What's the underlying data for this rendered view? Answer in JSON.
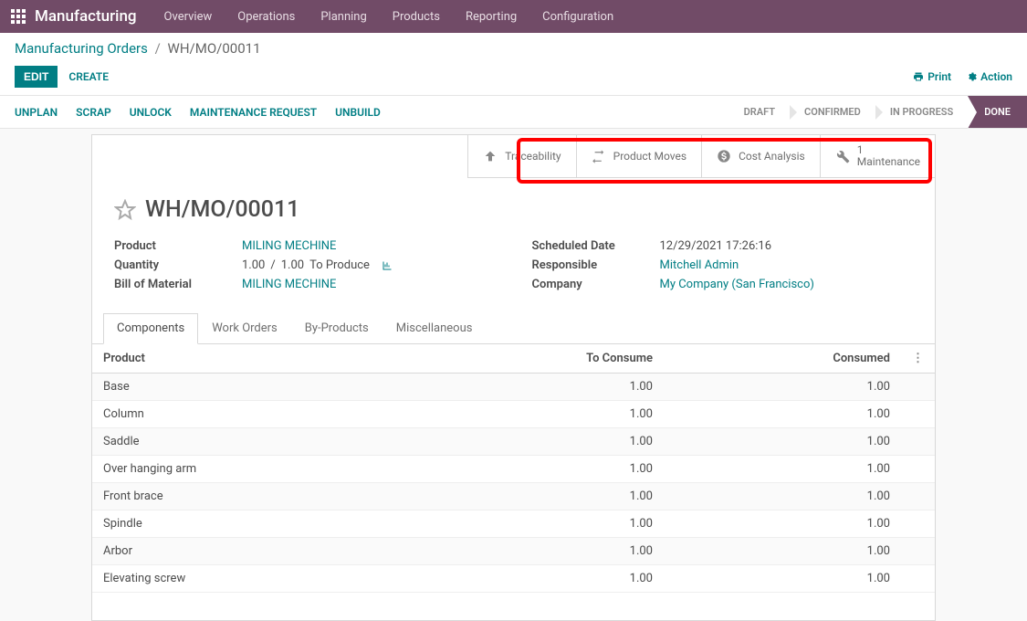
{
  "topnav": {
    "brand": "Manufacturing",
    "items": [
      "Overview",
      "Operations",
      "Planning",
      "Products",
      "Reporting",
      "Configuration"
    ]
  },
  "breadcrumb": {
    "root": "Manufacturing Orders",
    "current": "WH/MO/00011"
  },
  "buttons": {
    "edit": "EDIT",
    "create": "CREATE",
    "print": "Print",
    "action": "Action"
  },
  "status_actions": [
    "UNPLAN",
    "SCRAP",
    "UNLOCK",
    "MAINTENANCE REQUEST",
    "UNBUILD"
  ],
  "stages": [
    "DRAFT",
    "CONFIRMED",
    "IN PROGRESS",
    "DONE"
  ],
  "active_stage": "DONE",
  "stat_buttons": {
    "traceability": "Traceability",
    "product_moves": "Product Moves",
    "cost_analysis": "Cost Analysis",
    "maintenance_count": "1",
    "maintenance_label": "Maintenance"
  },
  "record": {
    "title": "WH/MO/00011"
  },
  "fields_left": {
    "product_label": "Product",
    "product_value": "MILING MECHINE",
    "quantity_label": "Quantity",
    "quantity_done": "1.00",
    "quantity_sep": "/",
    "quantity_planned": "1.00",
    "quantity_suffix": "To Produce",
    "bom_label": "Bill of Material",
    "bom_value": "MILING MECHINE"
  },
  "fields_right": {
    "scheduled_label": "Scheduled Date",
    "scheduled_value": "12/29/2021 17:26:16",
    "responsible_label": "Responsible",
    "responsible_value": "Mitchell Admin",
    "company_label": "Company",
    "company_value": "My Company (San Francisco)"
  },
  "tabs": [
    "Components",
    "Work Orders",
    "By-Products",
    "Miscellaneous"
  ],
  "active_tab": "Components",
  "table": {
    "headers": {
      "product": "Product",
      "to_consume": "To Consume",
      "consumed": "Consumed"
    },
    "rows": [
      {
        "product": "Base",
        "to_consume": "1.00",
        "consumed": "1.00"
      },
      {
        "product": "Column",
        "to_consume": "1.00",
        "consumed": "1.00"
      },
      {
        "product": "Saddle",
        "to_consume": "1.00",
        "consumed": "1.00"
      },
      {
        "product": "Over hanging arm",
        "to_consume": "1.00",
        "consumed": "1.00"
      },
      {
        "product": "Front brace",
        "to_consume": "1.00",
        "consumed": "1.00"
      },
      {
        "product": "Spindle",
        "to_consume": "1.00",
        "consumed": "1.00"
      },
      {
        "product": "Arbor",
        "to_consume": "1.00",
        "consumed": "1.00"
      },
      {
        "product": "Elevating screw",
        "to_consume": "1.00",
        "consumed": "1.00"
      }
    ]
  }
}
